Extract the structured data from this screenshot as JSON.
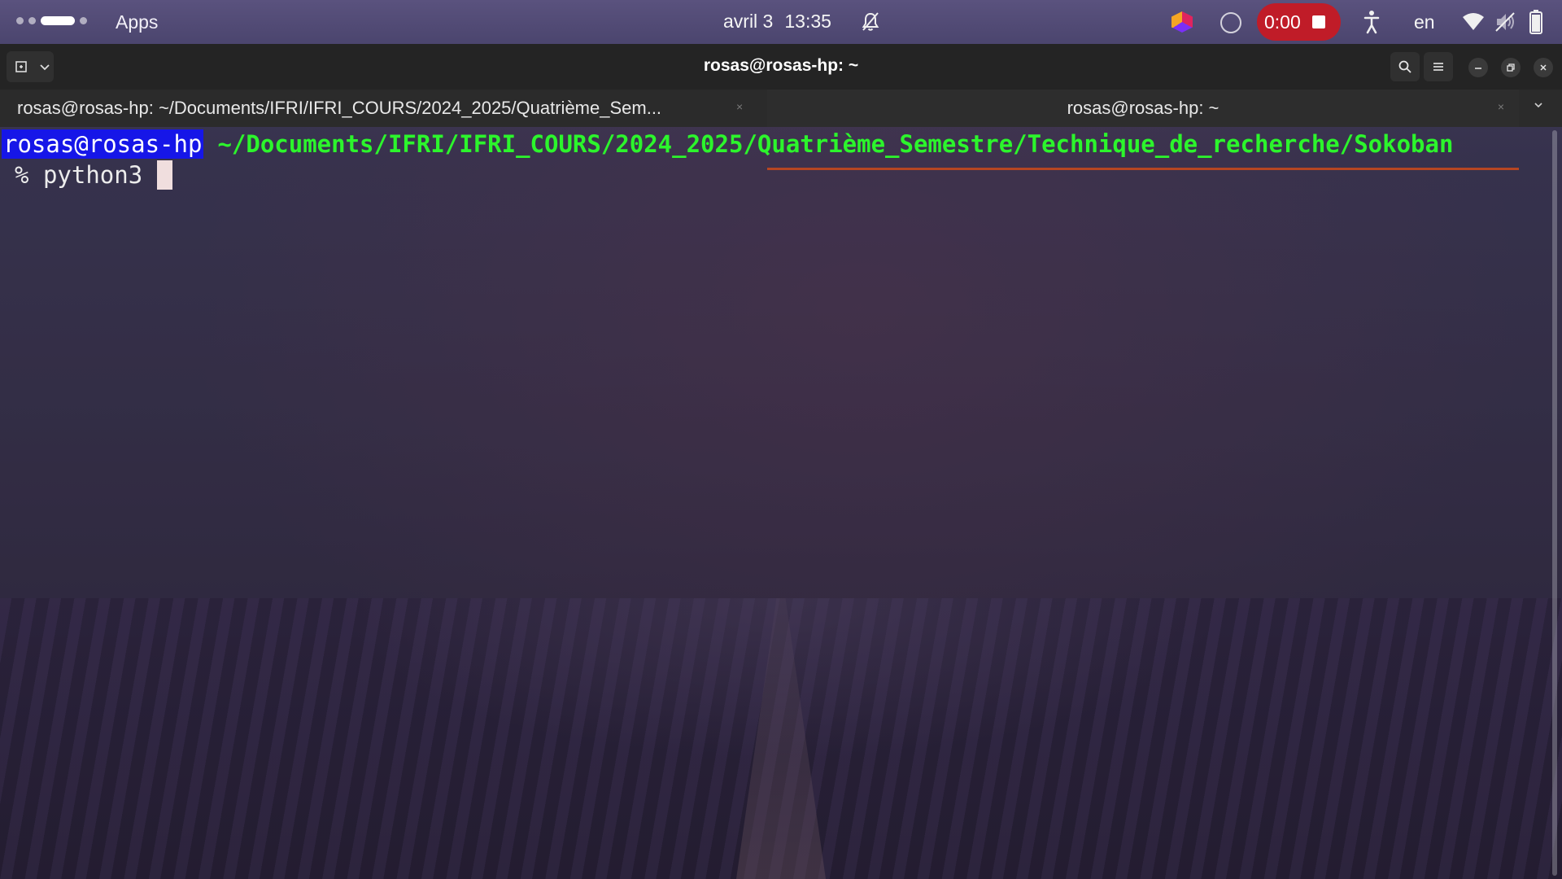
{
  "topbar": {
    "apps_label": "Apps",
    "date": "avril 3",
    "time": "13:35",
    "recording_timer": "0:00",
    "language": "en",
    "icons": [
      "workspace-indicator",
      "bell-muted-icon",
      "app-icon",
      "circle-icon",
      "stop-icon",
      "accessibility-icon",
      "wifi-icon",
      "volume-muted-icon",
      "battery-icon"
    ]
  },
  "window": {
    "title": "rosas@rosas-hp: ~",
    "tabs": [
      {
        "label": "rosas@rosas-hp: ~/Documents/IFRI/IFRI_COURS/2024_2025/Quatrième_Sem...",
        "active": false
      },
      {
        "label": "rosas@rosas-hp: ~",
        "active": true
      }
    ],
    "close_glyph": "×"
  },
  "terminal": {
    "user_host": "rosas@rosas-hp",
    "cwd": "~/Documents/IFRI/IFRI_COURS/2024_2025/Quatrième_Semestre/Technique_de_recherche/Sokoban",
    "prompt_symbol": "%",
    "command": "python3"
  },
  "colors": {
    "accent": "#e95420",
    "user_host_bg": "#1616e8",
    "cwd_text": "#2cf52c",
    "record_red": "#c01c28"
  }
}
